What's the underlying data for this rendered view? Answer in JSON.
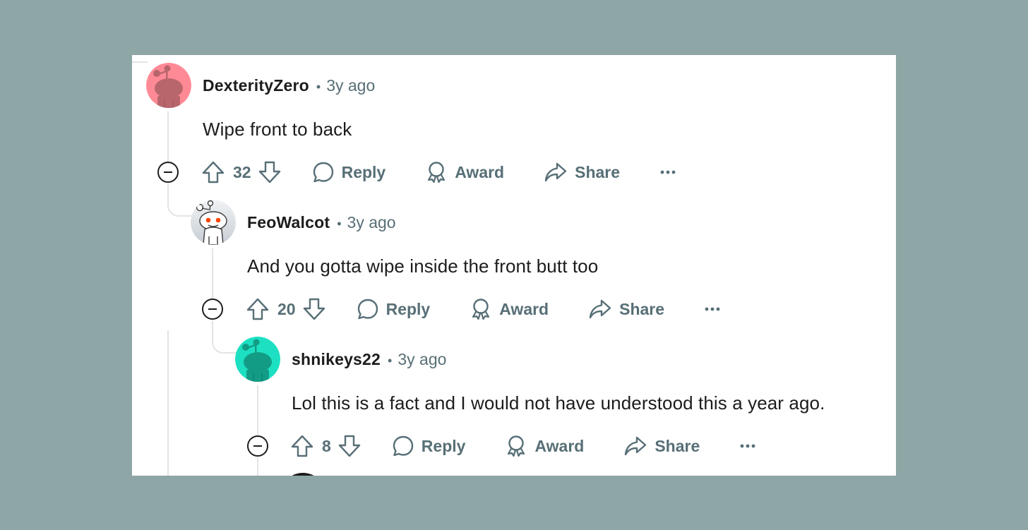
{
  "comments": [
    {
      "author": "DexterityZero",
      "separator": "•",
      "time": "3y ago",
      "body": "Wipe front to back",
      "score": "32",
      "avatar_color": "#ff8a96",
      "reply_label": "Reply",
      "award_label": "Award",
      "share_label": "Share"
    },
    {
      "author": "FeoWalcot",
      "separator": "•",
      "time": "3y ago",
      "body": "And you gotta wipe inside the front butt too",
      "score": "20",
      "avatar_color": "#dfe4e8",
      "reply_label": "Reply",
      "award_label": "Award",
      "share_label": "Share"
    },
    {
      "author": "shnikeys22",
      "separator": "•",
      "time": "3y ago",
      "body": "Lol this is a fact and I would not have understood this a year ago.",
      "score": "8",
      "avatar_color": "#1de0c2",
      "reply_label": "Reply",
      "award_label": "Award",
      "share_label": "Share"
    }
  ],
  "colors": {
    "page_background": "#8ea6a5",
    "card_background": "#ffffff",
    "text": "#1c1c1c",
    "muted": "#576f76",
    "thread_line": "#e1e4e6"
  },
  "icons": [
    "snoo-avatar-icon",
    "collapse-icon",
    "upvote-icon",
    "downvote-icon",
    "reply-icon",
    "award-icon",
    "share-icon",
    "more-icon"
  ]
}
